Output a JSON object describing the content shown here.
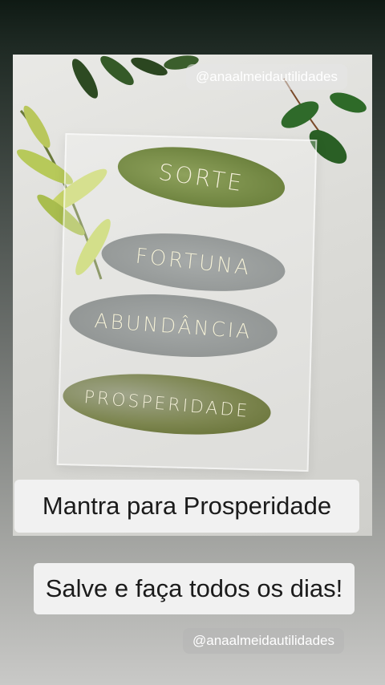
{
  "story": {
    "watermark_top": "@anaalmeidautilidades",
    "watermark_bottom": "@anaalmeidautilidades",
    "caption_1": "Mantra para Prosperidade",
    "caption_2": "Salve e faça todos os dias!"
  },
  "photo": {
    "leaves": [
      "SORTE",
      "FORTUNA",
      "ABUNDÂNCIA",
      "PROSPERIDADE"
    ]
  }
}
